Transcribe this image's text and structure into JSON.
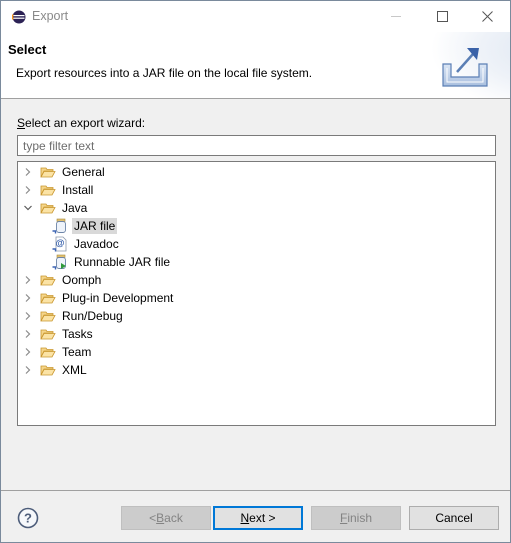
{
  "window": {
    "title": "Export",
    "controls": {
      "minimize": "minimize",
      "maximize": "maximize",
      "close": "close"
    }
  },
  "header": {
    "title": "Select",
    "description": "Export resources into a JAR file on the local file system.",
    "graphic": "export-wizard-banner-icon"
  },
  "wizard": {
    "label_prefix": "",
    "label_mnemonic": "S",
    "label_rest": "elect an export wizard:",
    "filter": {
      "value": "",
      "placeholder": "type filter text"
    },
    "tree": [
      {
        "label": "General",
        "type": "folder",
        "expanded": false,
        "level": 0
      },
      {
        "label": "Install",
        "type": "folder",
        "expanded": false,
        "level": 0
      },
      {
        "label": "Java",
        "type": "folder",
        "expanded": true,
        "level": 0
      },
      {
        "label": "JAR file",
        "type": "jar",
        "level": 1,
        "selected": true
      },
      {
        "label": "Javadoc",
        "type": "javadoc",
        "level": 1
      },
      {
        "label": "Runnable JAR file",
        "type": "runnable-jar",
        "level": 1
      },
      {
        "label": "Oomph",
        "type": "folder",
        "expanded": false,
        "level": 0
      },
      {
        "label": "Plug-in Development",
        "type": "folder",
        "expanded": false,
        "level": 0
      },
      {
        "label": "Run/Debug",
        "type": "folder",
        "expanded": false,
        "level": 0
      },
      {
        "label": "Tasks",
        "type": "folder",
        "expanded": false,
        "level": 0
      },
      {
        "label": "Team",
        "type": "folder",
        "expanded": false,
        "level": 0
      },
      {
        "label": "XML",
        "type": "folder",
        "expanded": false,
        "level": 0
      }
    ]
  },
  "footer": {
    "help_icon": "help-icon",
    "buttons": {
      "back": {
        "pre": "< ",
        "mnemonic": "B",
        "rest": "ack",
        "enabled": false
      },
      "next": {
        "pre": "",
        "mnemonic": "N",
        "rest": "ext >",
        "enabled": true,
        "default": true
      },
      "finish": {
        "pre": "",
        "mnemonic": "F",
        "rest": "inish",
        "enabled": false
      },
      "cancel": {
        "label": "Cancel",
        "enabled": true
      }
    }
  },
  "colors": {
    "accent": "#0078d7",
    "selection": "#d9d9d9",
    "folder": "#f5d58a",
    "banner_icon": "#5b7fb5"
  }
}
